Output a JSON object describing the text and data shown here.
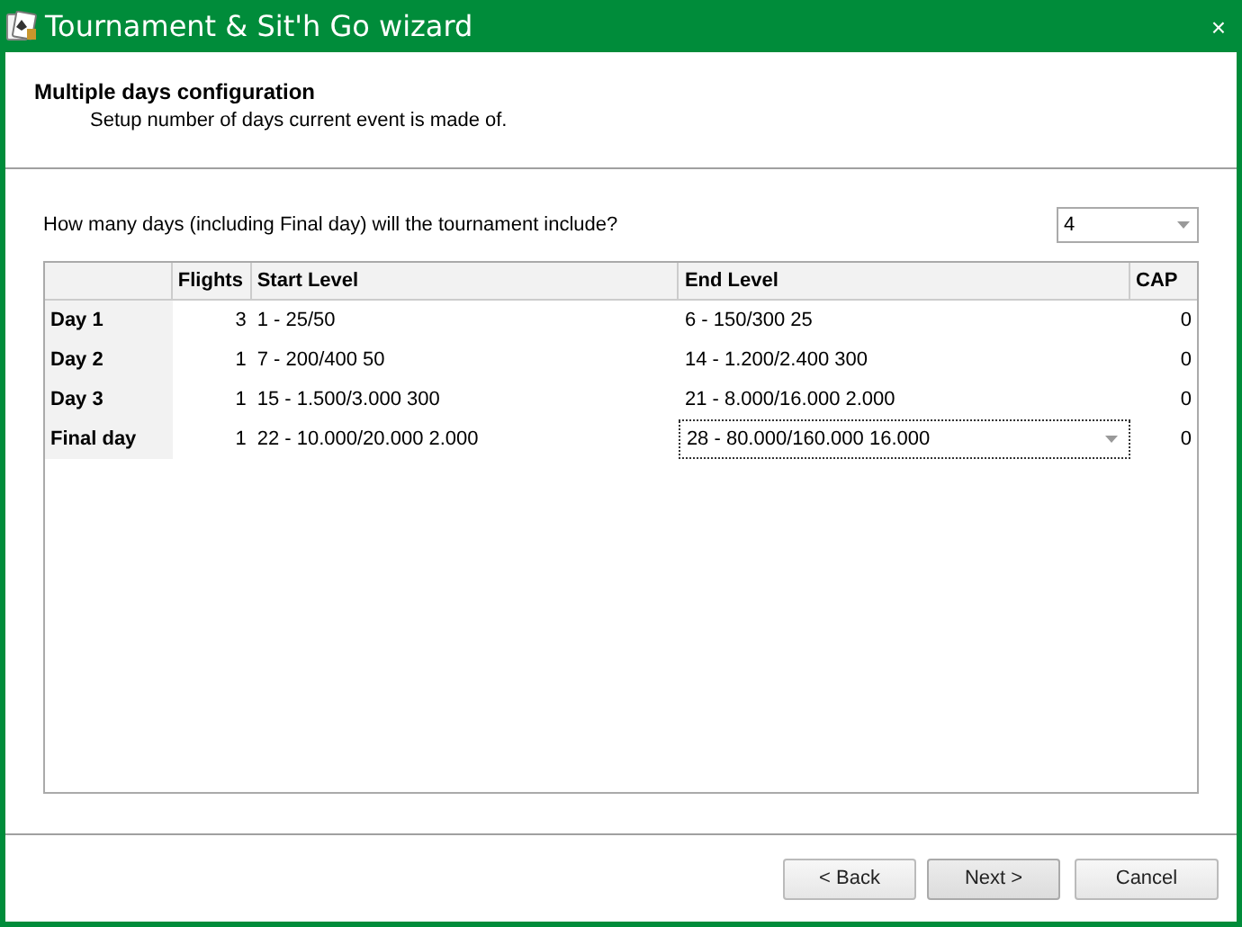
{
  "window": {
    "title": "Tournament & Sit'h Go wizard",
    "close": "×"
  },
  "header": {
    "title": "Multiple days configuration",
    "subtitle": "Setup number of days current event is made of."
  },
  "question": {
    "label": "How many days (including Final day) will the tournament include?",
    "value": "4"
  },
  "table": {
    "columns": [
      "Flights",
      "Start Level",
      "End Level",
      "CAP"
    ],
    "rows": [
      {
        "day": "Day 1",
        "flights": "3",
        "start_level": "1 - 25/50",
        "end_level": "6 - 150/300 25",
        "cap": "0",
        "editing": false
      },
      {
        "day": "Day 2",
        "flights": "1",
        "start_level": "7 - 200/400 50",
        "end_level": "14 - 1.200/2.400 300",
        "cap": "0",
        "editing": false
      },
      {
        "day": "Day 3",
        "flights": "1",
        "start_level": "15 - 1.500/3.000 300",
        "end_level": "21 - 8.000/16.000 2.000",
        "cap": "0",
        "editing": false
      },
      {
        "day": "Final day",
        "flights": "1",
        "start_level": "22 - 10.000/20.000 2.000",
        "end_level": "28 - 80.000/160.000 16.000",
        "cap": "0",
        "editing": true
      }
    ]
  },
  "buttons": [
    {
      "label": "< Back",
      "default": false
    },
    {
      "label": "Next >",
      "default": true
    },
    {
      "label": "Cancel",
      "default": false
    }
  ]
}
